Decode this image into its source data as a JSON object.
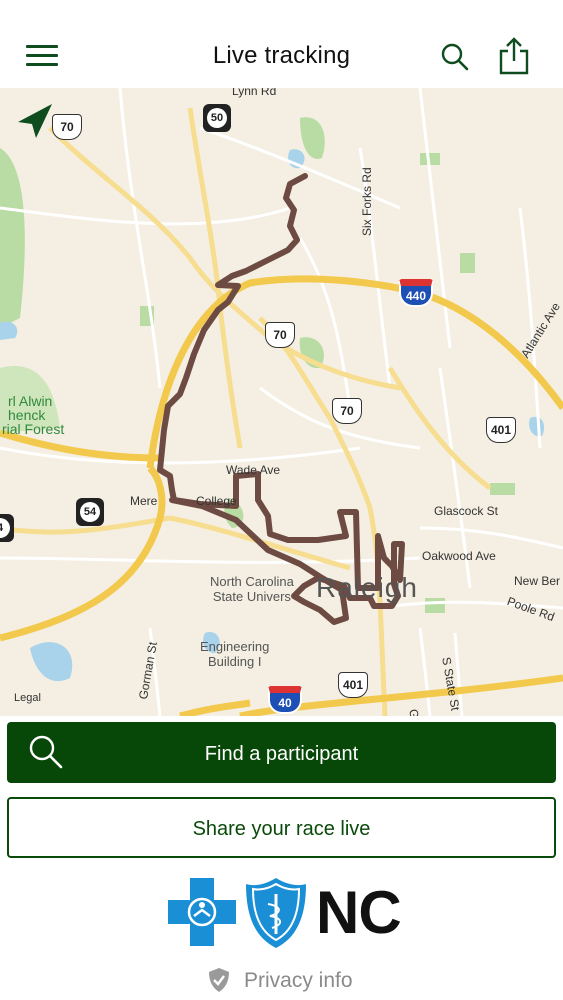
{
  "header": {
    "title": "Live tracking",
    "menu_icon": "hamburger-menu-icon",
    "search_icon": "search-icon",
    "share_icon": "share-icon"
  },
  "map": {
    "labels": {
      "lynn_rd": "Lynn Rd",
      "six_forks_rd": "Six Forks Rd",
      "atlantic_ave": "Atlantic Ave",
      "carl_alwin": "rl Alwin",
      "schenck": "henck",
      "memorial_forest": "rial Forest",
      "wade_ave": "Wade Ave",
      "meredith": "Mere",
      "college": "College",
      "glascock_st": "Glascock St",
      "oakwood_ave": "Oakwood Ave",
      "new_bern": "New Ber",
      "poole_rd": "Poole Rd",
      "ncsu": "North Carolina\nState Univers",
      "engineering": "Engineering\nBuilding I",
      "raleigh": "Raleigh",
      "gorman_st": "Gorman St",
      "garner_rd": "Garner Rd",
      "s_state_st": "S State St",
      "legal": "Legal"
    },
    "shields": {
      "us70_a": "70",
      "nc50": "50",
      "i440": "440",
      "us70_b": "70",
      "us70_c": "70",
      "us401_a": "401",
      "nc54": "54",
      "nc_left": "4",
      "us401_b": "401",
      "i40": "40"
    },
    "colors": {
      "route": "#6e4b42",
      "land": "#f4efe2",
      "park": "#b8dca3",
      "water": "#a9d3ea",
      "highway": "#f2c94c"
    }
  },
  "buttons": {
    "find_participant": "Find a participant",
    "share_race": "Share your race live"
  },
  "footer": {
    "brand_state": "NC",
    "privacy": "Privacy info"
  },
  "colors": {
    "primary": "#074809",
    "text": "#111111",
    "muted": "#8a8a8a"
  }
}
